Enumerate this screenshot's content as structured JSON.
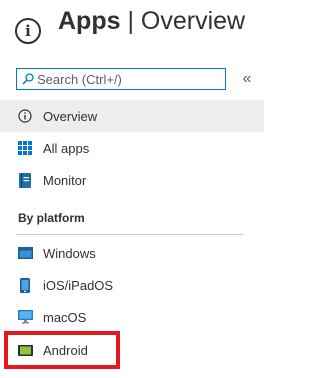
{
  "header": {
    "title_strong": "Apps",
    "separator": "|",
    "title_sub": "Overview"
  },
  "search": {
    "placeholder": "Search (Ctrl+/)"
  },
  "collapse_label": "«",
  "nav": [
    {
      "label": "Overview",
      "icon": "info-icon",
      "selected": true
    },
    {
      "label": "All apps",
      "icon": "grid-icon"
    },
    {
      "label": "Monitor",
      "icon": "monitor-book-icon"
    }
  ],
  "section": {
    "title": "By platform"
  },
  "platforms": [
    {
      "label": "Windows",
      "icon": "windows-icon"
    },
    {
      "label": "iOS/iPadOS",
      "icon": "phone-icon"
    },
    {
      "label": "macOS",
      "icon": "mac-monitor-icon"
    },
    {
      "label": "Android",
      "icon": "android-icon",
      "highlighted": true
    }
  ],
  "colors": {
    "accent": "#0078d4",
    "selected_bg": "#ededed",
    "highlight_border": "#e3181f",
    "android_green": "#8dc63f"
  }
}
